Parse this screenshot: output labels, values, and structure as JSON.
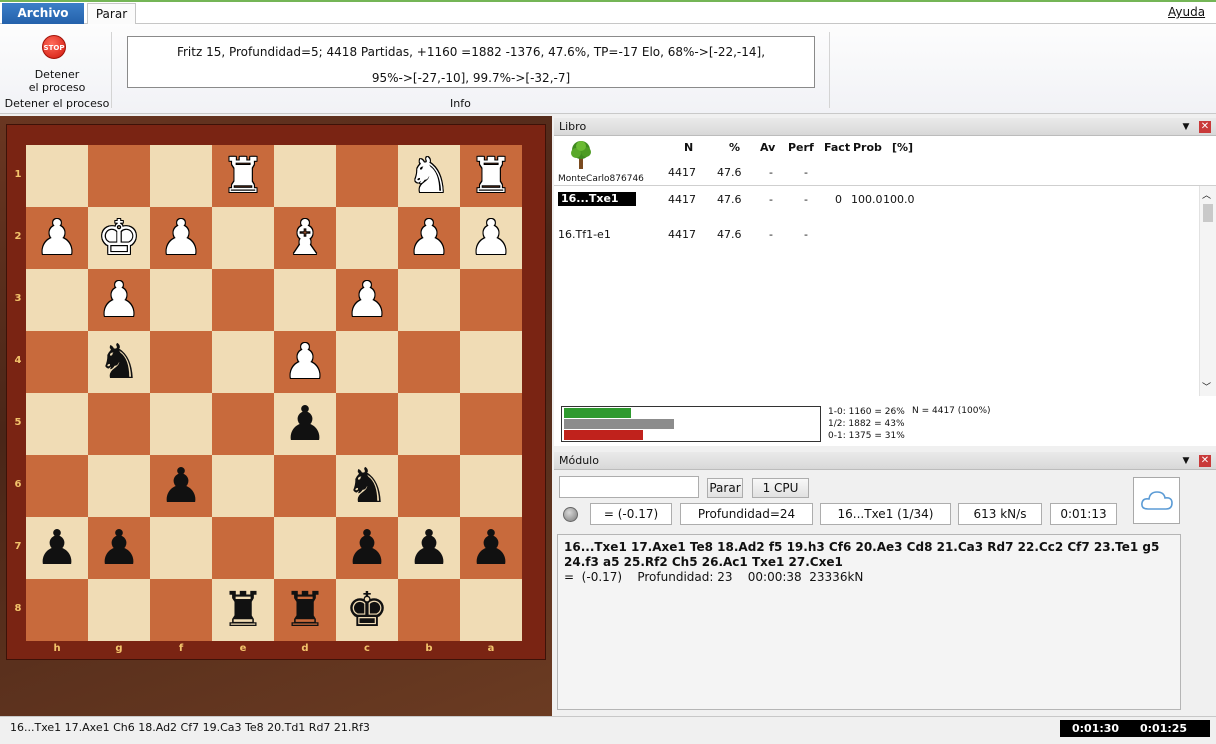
{
  "tabs": {
    "archivo": "Archivo",
    "parar": "Parar",
    "ayuda": "Ayuda"
  },
  "ribbon": {
    "stop_icon_text": "STOP",
    "stop_line1": "Detener",
    "stop_line2": "el proceso",
    "stop_group": "Detener el proceso",
    "info_line1": "Fritz 15, Profundidad=5; 4418 Partidas, +1160 =1882 -1376, 47.6%, TP=-17 Elo, 68%->[-22,-14],",
    "info_line2": "95%->[-27,-10], 99.7%->[-32,-7]",
    "info_group": "Info"
  },
  "board": {
    "ranks": [
      "1",
      "2",
      "3",
      "4",
      "5",
      "6",
      "7",
      "8"
    ],
    "files": [
      "h",
      "g",
      "f",
      "e",
      "d",
      "c",
      "b",
      "a"
    ],
    "pieces": [
      {
        "sq": "e1",
        "glyph": "♜",
        "color": "white"
      },
      {
        "sq": "b1",
        "glyph": "♞",
        "color": "white"
      },
      {
        "sq": "a1",
        "glyph": "♜",
        "color": "white"
      },
      {
        "sq": "h2",
        "glyph": "♟",
        "color": "white"
      },
      {
        "sq": "g2",
        "glyph": "♚",
        "color": "white"
      },
      {
        "sq": "f2",
        "glyph": "♟",
        "color": "white"
      },
      {
        "sq": "d2",
        "glyph": "♝",
        "color": "white"
      },
      {
        "sq": "b2",
        "glyph": "♟",
        "color": "white"
      },
      {
        "sq": "a2",
        "glyph": "♟",
        "color": "white"
      },
      {
        "sq": "g3",
        "glyph": "♟",
        "color": "white"
      },
      {
        "sq": "c3",
        "glyph": "♟",
        "color": "white"
      },
      {
        "sq": "g4",
        "glyph": "♞",
        "color": "black"
      },
      {
        "sq": "d4",
        "glyph": "♟",
        "color": "white"
      },
      {
        "sq": "d5",
        "glyph": "♟",
        "color": "black"
      },
      {
        "sq": "f6",
        "glyph": "♟",
        "color": "black"
      },
      {
        "sq": "c6",
        "glyph": "♞",
        "color": "black"
      },
      {
        "sq": "h7",
        "glyph": "♟",
        "color": "black"
      },
      {
        "sq": "g7",
        "glyph": "♟",
        "color": "black"
      },
      {
        "sq": "c7",
        "glyph": "♟",
        "color": "black"
      },
      {
        "sq": "b7",
        "glyph": "♟",
        "color": "black"
      },
      {
        "sq": "a7",
        "glyph": "♟",
        "color": "black"
      },
      {
        "sq": "e8",
        "glyph": "♜",
        "color": "black"
      },
      {
        "sq": "d8",
        "glyph": "♜",
        "color": "black"
      },
      {
        "sq": "c8",
        "glyph": "♚",
        "color": "black"
      }
    ]
  },
  "libro": {
    "title": "Libro",
    "headers": {
      "n": "N",
      "pct": "%",
      "av": "Av",
      "perf": "Perf",
      "fact": "Fact",
      "prob": "Prob",
      "prob2": "[%]"
    },
    "book_name": "MonteCarlo876746",
    "root": {
      "n": "4417",
      "pct": "47.6",
      "av": "-",
      "perf": "-"
    },
    "rows": [
      {
        "move": "16...Txe1",
        "n": "4417",
        "pct": "47.6",
        "av": "-",
        "perf": "-",
        "fact": "0",
        "prob": "100.0",
        "prob2": "100.0"
      },
      {
        "move": "16.Tf1-e1",
        "n": "4417",
        "pct": "47.6",
        "av": "-",
        "perf": "-",
        "fact": "",
        "prob": "",
        "prob2": ""
      }
    ],
    "stats": {
      "white": "1-0: 1160 = 26%",
      "draw": "1/2: 1882 = 43%",
      "black": "0-1: 1375 = 31%",
      "total": "N = 4417 (100%)",
      "white_frac": 0.26,
      "draw_frac": 0.43,
      "black_frac": 0.31,
      "colors": {
        "white": "#2e9a2e",
        "draw": "#8c8c8c",
        "black": "#c0221c"
      }
    }
  },
  "modulo": {
    "title": "Módulo",
    "engine_name": "",
    "stop_btn": "Parar",
    "cpu_btn": "1 CPU",
    "eval": "=  (-0.17)",
    "depth": "Profundidad=24",
    "current_move": "16...Txe1 (1/34)",
    "speed": "613 kN/s",
    "time": "0:01:13",
    "pv": "16...Txe1 17.Axe1 Te8 18.Ad2 f5 19.h3 Cf6 20.Ae3 Cd8 21.Ca3 Rd7 22.Cc2 Cf7 23.Te1 g5 24.f3 a5 25.Rf2 Ch5 26.Ac1 Txe1 27.Cxe1",
    "pv_info": "=  (-0.17)    Profundidad: 23    00:00:38  23336kN"
  },
  "status": {
    "line": "16...Txe1 17.Axe1 Ch6 18.Ad2 Cf7 19.Ca3 Te8 20.Td1 Rd7 21.Rf3",
    "clock_white": "0:01:30",
    "clock_black": "0:01:25"
  }
}
